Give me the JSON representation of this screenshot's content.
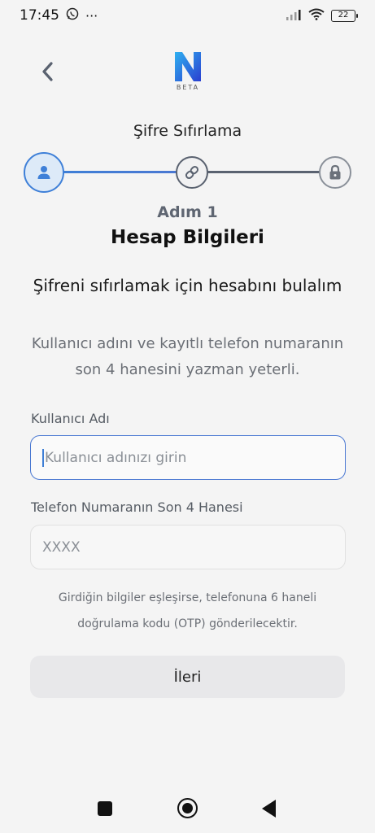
{
  "status_bar": {
    "time": "17:45",
    "more": "···",
    "battery": "22"
  },
  "header": {
    "logo_letter": "N",
    "logo_sub": "BETA",
    "title": "Şifre Sıfırlama"
  },
  "stepper": {
    "current_step": 1,
    "total_steps": 3,
    "steps": [
      "user-icon",
      "link-icon",
      "lock-icon"
    ],
    "active_color": "#3f80d8",
    "inactive_color": "#5a6270"
  },
  "step": {
    "number": "Adım 1",
    "heading": "Hesap Bilgileri",
    "subtitle": "Şifreni sıfırlamak için hesabını bulalım",
    "description": "Kullanıcı adını ve kayıtlı telefon numaranın son 4 hanesini yazman yeterli."
  },
  "form": {
    "username_label": "Kullanıcı Adı",
    "username_placeholder": "Kullanıcı adınızı girin",
    "phone_label": "Telefon Numaranın Son 4 Hanesi",
    "phone_placeholder": "XXXX",
    "note": "Girdiğin bilgiler eşleşirse, telefonuna 6 haneli doğrulama kodu (OTP) gönderilecektir.",
    "next_label": "İleri"
  },
  "colors": {
    "accent": "#3f80d8",
    "background": "#f4f4f4"
  }
}
